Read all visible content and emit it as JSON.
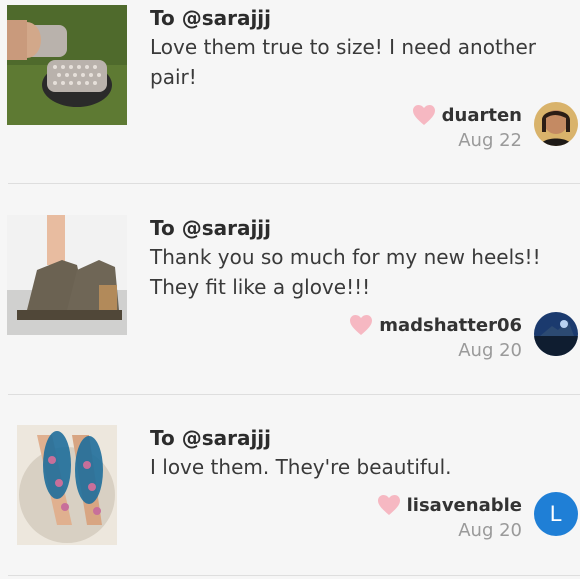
{
  "comments": [
    {
      "to": "To @sarajjj",
      "message_lines": [
        "Love them true to size! I need another",
        "pair!"
      ],
      "username": "duarten",
      "date": "Aug 22",
      "thumb_desc": "sandals-photo",
      "avatar": "photo"
    },
    {
      "to": "To @sarajjj",
      "message_lines": [
        "Thank you so much for my new heels!!",
        "They fit like a glove!!!"
      ],
      "username": "madshatter06",
      "date": "Aug 20",
      "thumb_desc": "heels-photo",
      "avatar": "photo"
    },
    {
      "to": "To @sarajjj",
      "message_lines": [
        "I love them. They're beautiful."
      ],
      "username": "lisavenable",
      "date": "Aug 20",
      "thumb_desc": "jeweled-sandals-photo",
      "avatar": "L"
    }
  ],
  "colors": {
    "heart": "#f6b8c2",
    "avatar_blue": "#1f7fd6",
    "divider": "#dedede"
  },
  "icons": {
    "heart": "heart-icon"
  }
}
